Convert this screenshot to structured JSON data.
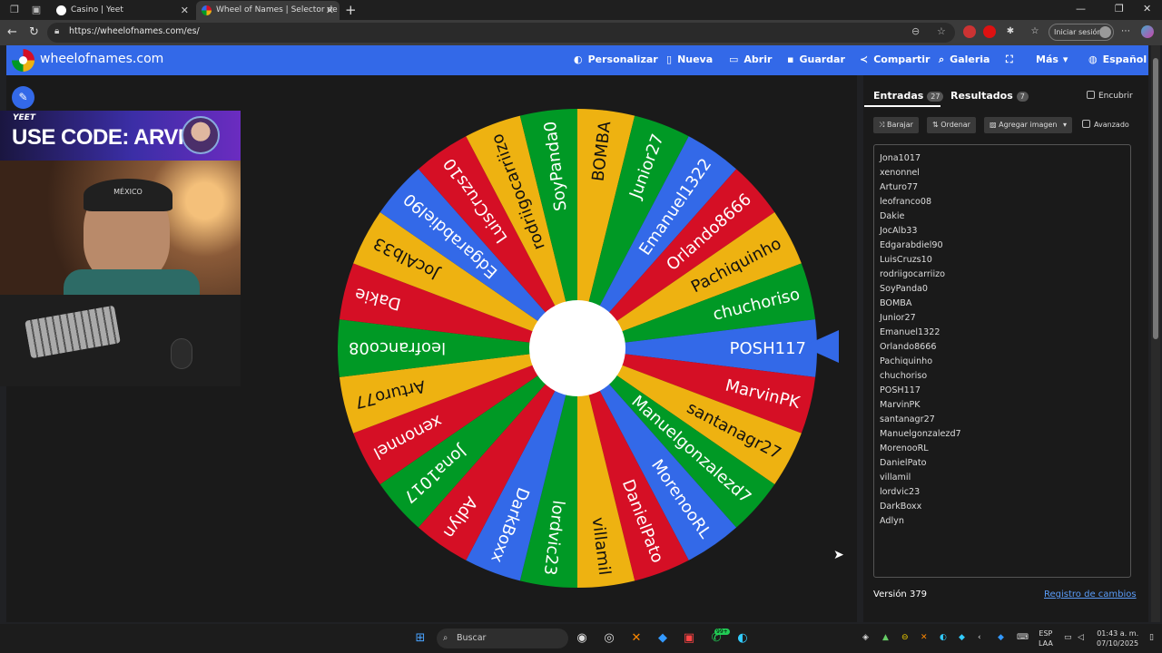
{
  "browser": {
    "tabs": [
      {
        "title": "Casino | Yeet",
        "active": false
      },
      {
        "title": "Wheel of Names | Selector de nom",
        "active": true
      }
    ],
    "url": "https://wheelofnames.com/es/",
    "signin_label": "Iniciar sesión"
  },
  "header": {
    "site_name": "wheelofnames.com",
    "nav": [
      {
        "label": "Personalizar",
        "icon": "palette-icon"
      },
      {
        "label": "Nueva",
        "icon": "file-icon"
      },
      {
        "label": "Abrir",
        "icon": "folder-icon"
      },
      {
        "label": "Guardar",
        "icon": "save-icon"
      },
      {
        "label": "Compartir",
        "icon": "share-icon"
      },
      {
        "label": "Galeria",
        "icon": "search-icon"
      },
      {
        "label": "",
        "icon": "fullscreen-icon"
      },
      {
        "label": "Más",
        "icon": "chevron-down-icon"
      },
      {
        "label": "Español",
        "icon": "globe-icon"
      }
    ]
  },
  "stream": {
    "brand": "YEET",
    "promo": "USE CODE: ARVIX",
    "cap_text": "MÉXICO"
  },
  "wheel": {
    "colors": [
      "#3369e8",
      "#d50f25",
      "#eeb211",
      "#009925"
    ],
    "center_color": "#ffffff"
  },
  "panel": {
    "entries_tab": "Entradas",
    "entries_count": "27",
    "results_tab": "Resultados",
    "results_count": "7",
    "hide_label": "Encubrir",
    "shuffle_label": "Barajar",
    "sort_label": "Ordenar",
    "add_image_label": "Agregar imagen",
    "advanced_label": "Avanzado",
    "entries": [
      "Jona1017",
      "xenonnel",
      "Arturo77",
      "leofranco08",
      "Dakie",
      "JocAlb33",
      "Edgarabdiel90",
      "LuisCruzs10",
      "rodriigocarriizo",
      "SoyPanda0",
      "BOMBA",
      "Junior27",
      "Emanuel1322",
      "Orlando8666",
      "Pachiquinho",
      "chuchoriso",
      "POSH117",
      "MarvinPK",
      "santanagr27",
      "Manuelgonzalezd7",
      "MorenooRL",
      "DanielPato",
      "villamil",
      "lordvic23",
      "DarkBoxx",
      "Adlyn"
    ],
    "version": "Versión 379",
    "changelog": "Registro de cambios"
  },
  "taskbar": {
    "search_placeholder": "Buscar",
    "badge": "99+",
    "lang_line1": "ESP",
    "lang_line2": "LAA",
    "time": "01:43 a. m.",
    "date": "07/10/2025"
  }
}
